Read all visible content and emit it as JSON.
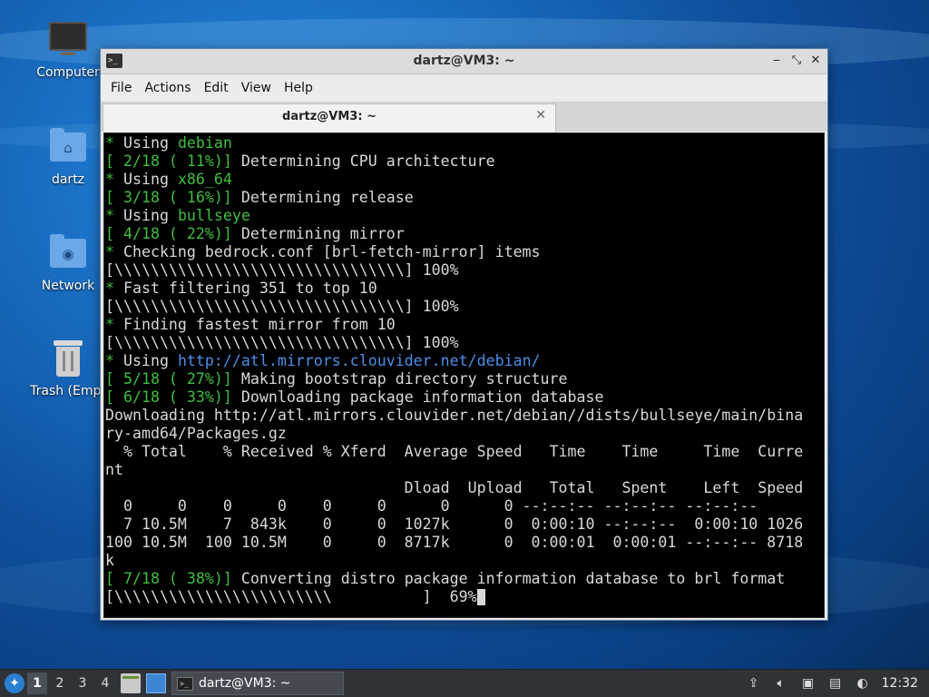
{
  "desktop": {
    "icons": [
      {
        "label": "Computer",
        "icon": "computer-icon"
      },
      {
        "label": "dartz",
        "icon": "home-folder-icon"
      },
      {
        "label": "Network",
        "icon": "network-folder-icon"
      },
      {
        "label": "Trash (Empt",
        "icon": "trash-icon"
      }
    ]
  },
  "window": {
    "title": "dartz@VM3: ~",
    "menu": [
      "File",
      "Actions",
      "Edit",
      "View",
      "Help"
    ],
    "tab_label": "dartz@VM3: ~",
    "tab_close": "✕",
    "controls": {
      "minimize": "‒",
      "maximize": "⤡",
      "close": "✕"
    }
  },
  "terminal": {
    "lines": [
      [
        {
          "t": "* ",
          "c": "g"
        },
        {
          "t": "Using "
        },
        {
          "t": "debian",
          "c": "g"
        }
      ],
      [
        {
          "t": "[ 2/18 ( 11%)]",
          "c": "g"
        },
        {
          "t": " Determining CPU architecture"
        }
      ],
      [
        {
          "t": "* ",
          "c": "g"
        },
        {
          "t": "Using "
        },
        {
          "t": "x86_64",
          "c": "g"
        }
      ],
      [
        {
          "t": "[ 3/18 ( 16%)]",
          "c": "g"
        },
        {
          "t": " Determining release"
        }
      ],
      [
        {
          "t": "* ",
          "c": "g"
        },
        {
          "t": "Using "
        },
        {
          "t": "bullseye",
          "c": "g"
        }
      ],
      [
        {
          "t": "[ 4/18 ( 22%)]",
          "c": "g"
        },
        {
          "t": " Determining mirror"
        }
      ],
      [
        {
          "t": "* ",
          "c": "g"
        },
        {
          "t": "Checking bedrock.conf [brl-fetch-mirror] items"
        }
      ],
      [
        {
          "t": "[\\\\\\\\\\\\\\\\\\\\\\\\\\\\\\\\\\\\\\\\\\\\\\\\\\\\\\\\\\\\\\\\] 100%"
        }
      ],
      [
        {
          "t": "* ",
          "c": "g"
        },
        {
          "t": "Fast filtering 351 to top 10"
        }
      ],
      [
        {
          "t": "[\\\\\\\\\\\\\\\\\\\\\\\\\\\\\\\\\\\\\\\\\\\\\\\\\\\\\\\\\\\\\\\\] 100%"
        }
      ],
      [
        {
          "t": "* ",
          "c": "g"
        },
        {
          "t": "Finding fastest mirror from 10"
        }
      ],
      [
        {
          "t": "[\\\\\\\\\\\\\\\\\\\\\\\\\\\\\\\\\\\\\\\\\\\\\\\\\\\\\\\\\\\\\\\\] 100%"
        }
      ],
      [
        {
          "t": "* ",
          "c": "g"
        },
        {
          "t": "Using "
        },
        {
          "t": "http://atl.mirrors.clouvider.net/debian/",
          "c": "b"
        }
      ],
      [
        {
          "t": "[ 5/18 ( 27%)]",
          "c": "g"
        },
        {
          "t": " Making bootstrap directory structure"
        }
      ],
      [
        {
          "t": "[ 6/18 ( 33%)]",
          "c": "g"
        },
        {
          "t": " Downloading package information database"
        }
      ],
      [
        {
          "t": "Downloading http://atl.mirrors.clouvider.net/debian//dists/bullseye/main/bina"
        }
      ],
      [
        {
          "t": "ry-amd64/Packages.gz"
        }
      ],
      [
        {
          "t": "  % Total    % Received % Xferd  Average Speed   Time    Time     Time  Curre"
        }
      ],
      [
        {
          "t": "nt"
        }
      ],
      [
        {
          "t": "                                 Dload  Upload   Total   Spent    Left  Speed"
        }
      ],
      [
        {
          "t": "  0     0    0     0    0     0      0      0 --:--:-- --:--:-- --:--:--"
        }
      ],
      [
        {
          "t": "  7 10.5M    7  843k    0     0  1027k      0  0:00:10 --:--:--  0:00:10 1026"
        }
      ],
      [
        {
          "t": "100 10.5M  100 10.5M    0     0  8717k      0  0:00:01  0:00:01 --:--:-- 8718"
        }
      ],
      [
        {
          "t": "k"
        }
      ],
      [
        {
          "t": "[ 7/18 ( 38%)]",
          "c": "g"
        },
        {
          "t": " Converting distro package information database to brl format"
        }
      ],
      [
        {
          "t": "[\\\\\\\\\\\\\\\\\\\\\\\\\\\\\\\\\\\\\\\\\\\\\\\\          ]  69%"
        },
        {
          "cursor": true
        }
      ]
    ]
  },
  "taskbar": {
    "workspaces": [
      "1",
      "2",
      "3",
      "4"
    ],
    "active_workspace": "1",
    "task_label": "dartz@VM3: ~",
    "clock": "12:32"
  }
}
